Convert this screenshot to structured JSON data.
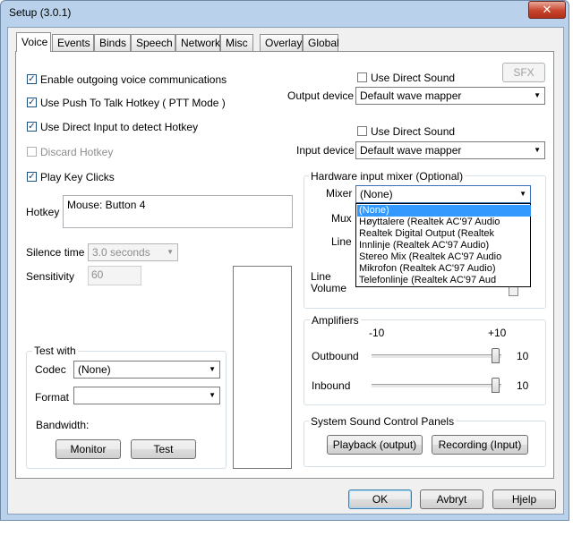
{
  "window": {
    "title": "Setup (3.0.1)",
    "close_glyph": "✕"
  },
  "tabs": [
    {
      "label": "Voice",
      "active": true
    },
    {
      "label": "Events"
    },
    {
      "label": "Binds"
    },
    {
      "label": "Speech"
    },
    {
      "label": "Network"
    },
    {
      "label": "Misc"
    },
    {
      "label": "Overlay"
    },
    {
      "label": "Global"
    }
  ],
  "voice": {
    "enable_outgoing": {
      "label": "Enable outgoing voice communications",
      "checked": true
    },
    "push_to_talk": {
      "label": "Use Push To Talk Hotkey ( PTT Mode )",
      "checked": true
    },
    "direct_input": {
      "label": "Use Direct Input to detect Hotkey",
      "checked": true
    },
    "discard_hotkey": {
      "label": "Discard Hotkey",
      "checked": false,
      "disabled": true
    },
    "play_key_clicks": {
      "label": "Play Key Clicks",
      "checked": true
    },
    "hotkey_label": "Hotkey",
    "hotkey_value": "Mouse: Button 4",
    "silence_label": "Silence time",
    "silence_value": "3.0 seconds",
    "sensitivity_label": "Sensitivity",
    "sensitivity_value": "60"
  },
  "test_with": {
    "title": "Test with",
    "codec_label": "Codec",
    "codec_value": "(None)",
    "format_label": "Format",
    "format_value": "",
    "bandwidth_label": "Bandwidth:",
    "monitor_button": "Monitor",
    "test_button": "Test"
  },
  "devices": {
    "sfx_button": "SFX",
    "output_direct_sound": {
      "label": "Use Direct Sound",
      "checked": false
    },
    "output_label": "Output device",
    "output_value": "Default wave mapper",
    "input_direct_sound": {
      "label": "Use Direct Sound",
      "checked": false
    },
    "input_label": "Input device",
    "input_value": "Default wave mapper"
  },
  "mixer": {
    "title": "Hardware input mixer (Optional)",
    "mixer_label": "Mixer",
    "mixer_value": "(None)",
    "mux_label": "Mux",
    "line_label": "Line",
    "line_volume_label": "Line Volume",
    "options": [
      "(None)",
      "Høyttalere (Realtek AC'97 Audio",
      "Realtek Digital Output (Realtek",
      "Innlinje (Realtek AC'97 Audio)",
      "Stereo Mix (Realtek AC'97 Audio",
      "Mikrofon (Realtek AC'97 Audio)",
      "Telefonlinje (Realtek AC'97 Aud"
    ],
    "selected_index": 0
  },
  "amplifiers": {
    "title": "Amplifiers",
    "min_label": "-10",
    "max_label": "+10",
    "outbound_label": "Outbound",
    "outbound_value": "10",
    "inbound_label": "Inbound",
    "inbound_value": "10"
  },
  "sound_panels": {
    "title": "System Sound Control Panels",
    "playback_button": "Playback (output)",
    "recording_button": "Recording (Input)"
  },
  "footer": {
    "ok": "OK",
    "cancel": "Avbryt",
    "help": "Hjelp"
  }
}
